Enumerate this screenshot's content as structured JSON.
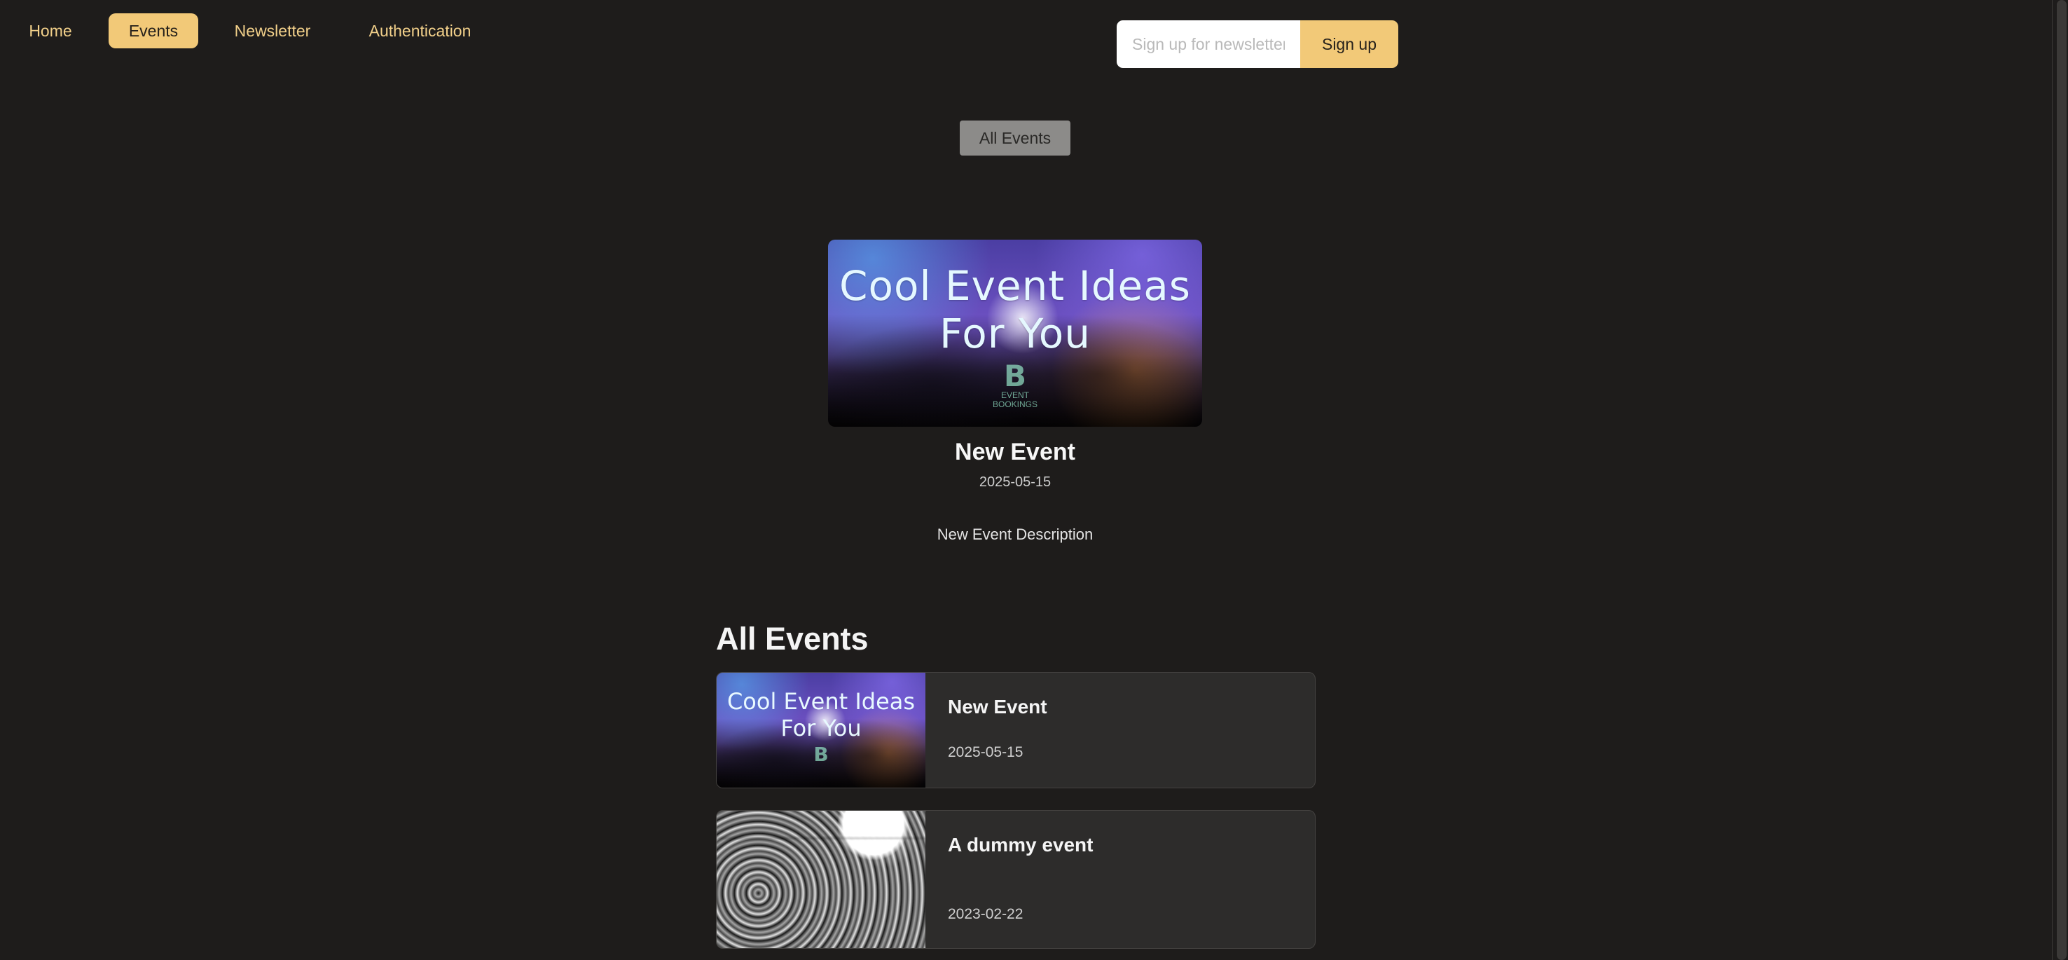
{
  "nav": {
    "items": [
      {
        "label": "Home"
      },
      {
        "label": "Events"
      },
      {
        "label": "Newsletter"
      },
      {
        "label": "Authentication"
      }
    ]
  },
  "newsletter": {
    "placeholder": "Sign up for newsletter...",
    "button_label": "Sign up"
  },
  "subnav": {
    "all_events_label": "All Events"
  },
  "featured": {
    "image_title_line1": "Cool Event Ideas",
    "image_title_line2": "For You",
    "logo_mark": "B",
    "logo_text_line1": "EVENT",
    "logo_text_line2": "BOOKINGS",
    "title": "New Event",
    "date": "2025-05-15",
    "description": "New Event Description"
  },
  "events": {
    "heading": "All Events",
    "items": [
      {
        "title": "New Event",
        "date": "2025-05-15",
        "thumb_line1": "Cool Event Ideas",
        "thumb_line2": "For You",
        "thumb_logo": "B"
      },
      {
        "title": "A dummy event",
        "date": "2023-02-22"
      }
    ]
  },
  "colors": {
    "background": "#1e1c1b",
    "accent": "#f2c978",
    "card_background": "#2d2c2b",
    "subnav_button": "#8c8b89"
  }
}
